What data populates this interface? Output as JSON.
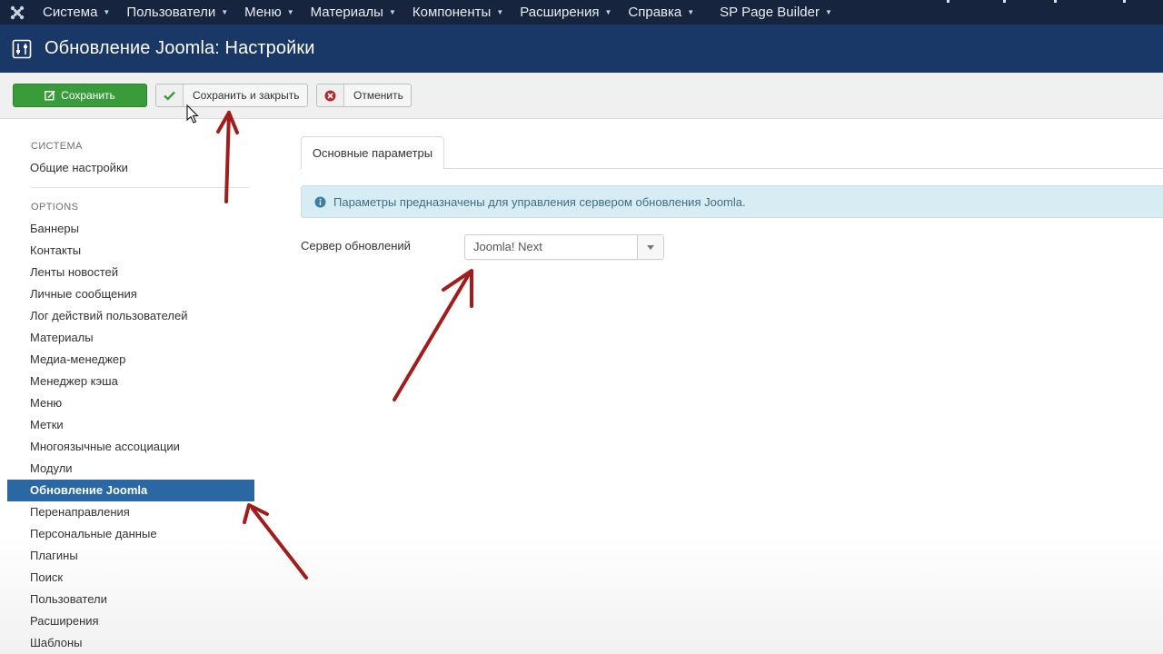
{
  "navbar": {
    "logo_icon": "joomla-logo-icon",
    "items": [
      {
        "label": "Система"
      },
      {
        "label": "Пользователи"
      },
      {
        "label": "Меню"
      },
      {
        "label": "Материалы"
      },
      {
        "label": "Компоненты"
      },
      {
        "label": "Расширения"
      },
      {
        "label": "Справка"
      },
      {
        "label": "SP Page Builder"
      }
    ]
  },
  "header": {
    "icon": "settings-sliders-icon",
    "title": "Обновление Joomla: Настройки"
  },
  "toolbar": {
    "save_label": "Сохранить",
    "save_close_label": "Сохранить и закрыть",
    "cancel_label": "Отменить",
    "colors": {
      "save_bg": "#3a9b3a",
      "cancel_icon": "#b52a2a",
      "check_icon": "#3a9b3a"
    }
  },
  "sidebar": {
    "section1": "СИСТЕМА",
    "section1_items": [
      {
        "label": "Общие настройки"
      }
    ],
    "section2": "OPTIONS",
    "items": [
      {
        "label": "Баннеры"
      },
      {
        "label": "Контакты"
      },
      {
        "label": "Ленты новостей"
      },
      {
        "label": "Личные сообщения"
      },
      {
        "label": "Лог действий пользователей"
      },
      {
        "label": "Материалы"
      },
      {
        "label": "Медиа-менеджер"
      },
      {
        "label": "Менеджер кэша"
      },
      {
        "label": "Меню"
      },
      {
        "label": "Метки"
      },
      {
        "label": "Многоязычные ассоциации"
      },
      {
        "label": "Модули"
      },
      {
        "label": "Обновление Joomla",
        "active": true
      },
      {
        "label": "Перенаправления"
      },
      {
        "label": "Персональные данные"
      },
      {
        "label": "Плагины"
      },
      {
        "label": "Поиск"
      },
      {
        "label": "Пользователи"
      },
      {
        "label": "Расширения"
      },
      {
        "label": "Шаблоны"
      }
    ],
    "active_color": "#2a67a3"
  },
  "main": {
    "tab_label": "Основные параметры",
    "alert_text": "Параметры предназначены для управления сервером обновления Joomla.",
    "field_label": "Сервер обновлений",
    "select_value": "Joomla! Next"
  }
}
